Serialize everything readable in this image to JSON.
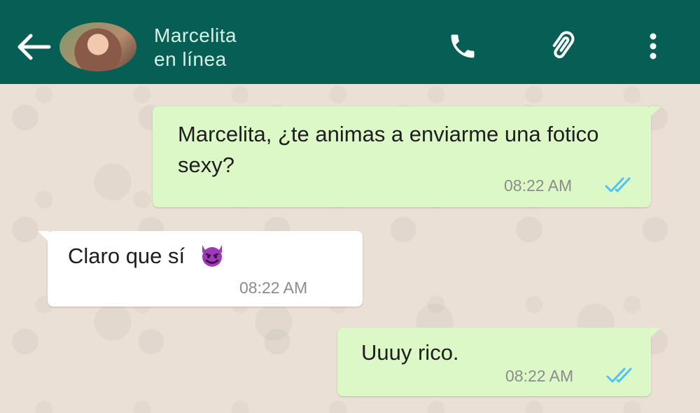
{
  "header": {
    "contact_name": "Marcelita",
    "contact_status": "en línea",
    "background_color": "#075e54",
    "icons": [
      "back-arrow-icon",
      "phone-icon",
      "paperclip-icon",
      "more-vert-icon"
    ]
  },
  "messages": [
    {
      "direction": "outgoing",
      "text": "Marcelita, ¿te animas a enviarme una fotico sexy?",
      "time": "08:22 AM",
      "status": "read"
    },
    {
      "direction": "incoming",
      "text": "Claro que sí",
      "emoji": "smiling-devil-emoji",
      "time": "08:22 AM"
    },
    {
      "direction": "outgoing",
      "text": "Uuuy rico.",
      "time": "08:22 AM",
      "status": "read"
    }
  ],
  "colors": {
    "outgoing_bubble": "#dcf8c6",
    "incoming_bubble": "#ffffff",
    "read_ticks": "#4fc3f7"
  }
}
